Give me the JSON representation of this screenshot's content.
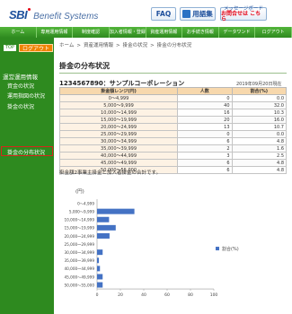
{
  "header": {
    "logo_sbi": "SBI",
    "logo_text": "Benefit Systems",
    "faq_label": "FAQ",
    "glossary_label": "用語集",
    "mail_line1": "メッセージボード",
    "mail_line2": "お問合せは こちら"
  },
  "gnav": {
    "items": [
      "ホーム",
      "専用運用情報",
      "制度確認",
      "加入者情報・登録",
      "資産運用情報",
      "お手続き情報",
      "データワンド",
      "ログアウト"
    ]
  },
  "sidebar": {
    "top_badge": "TOP",
    "logout_label": "ログアウト",
    "items": [
      {
        "label": "運営運用情報"
      },
      {
        "label": "資金の状況"
      },
      {
        "label": "運用指図の状況"
      },
      {
        "label": "掛金の状況"
      },
      {
        "label": "掛金の分布状況"
      }
    ]
  },
  "breadcrumb": {
    "items": [
      "ホーム",
      "資産運用情報",
      "掛金の状況",
      "掛金の分布状況"
    ]
  },
  "page": {
    "title": "掛金の分布状況",
    "plan_name": "1234567890：サンプルコーポレーション",
    "as_of": "2019年09月20日現在",
    "note": "掛金額2事業主掛金と加入者掛金の合計です。"
  },
  "table": {
    "headers": [
      "掛金額レンジ(円)",
      "人数",
      "割合(%)"
    ],
    "rows": [
      {
        "range": "0〜4,999",
        "count": "0",
        "pct": "0.0"
      },
      {
        "range": "5,000〜9,999",
        "count": "40",
        "pct": "32.0"
      },
      {
        "range": "10,000〜14,999",
        "count": "16",
        "pct": "10.3"
      },
      {
        "range": "15,000〜19,999",
        "count": "20",
        "pct": "16.0"
      },
      {
        "range": "20,000〜24,999",
        "count": "13",
        "pct": "10.7"
      },
      {
        "range": "25,000〜29,999",
        "count": "0",
        "pct": "0.0"
      },
      {
        "range": "30,000〜34,999",
        "count": "6",
        "pct": "4.8"
      },
      {
        "range": "35,000〜39,999",
        "count": "2",
        "pct": "1.6"
      },
      {
        "range": "40,000〜44,999",
        "count": "3",
        "pct": "2.5"
      },
      {
        "range": "45,000〜49,999",
        "count": "6",
        "pct": "4.8"
      },
      {
        "range": "50,000〜55,000",
        "count": "6",
        "pct": "4.8"
      }
    ]
  },
  "chart_data": {
    "type": "bar",
    "orientation": "horizontal",
    "categories": [
      "0〜4,999",
      "5,000〜9,999",
      "10,000〜14,999",
      "15,000〜19,999",
      "20,000〜24,999",
      "25,000〜29,999",
      "30,000〜34,999",
      "35,000〜39,999",
      "40,000〜44,999",
      "45,000〜49,999",
      "50,000〜55,000"
    ],
    "series": [
      {
        "name": "割合(%)",
        "values": [
          0.0,
          32.0,
          10.3,
          16.0,
          10.7,
          0.0,
          4.8,
          1.6,
          2.5,
          4.8,
          4.8
        ]
      }
    ],
    "unit_label": "(円)",
    "xlim": [
      0,
      100
    ],
    "xticks": [
      0,
      20,
      40,
      60,
      80,
      100
    ],
    "legend_position": "right",
    "bar_color": "#4472c4"
  }
}
